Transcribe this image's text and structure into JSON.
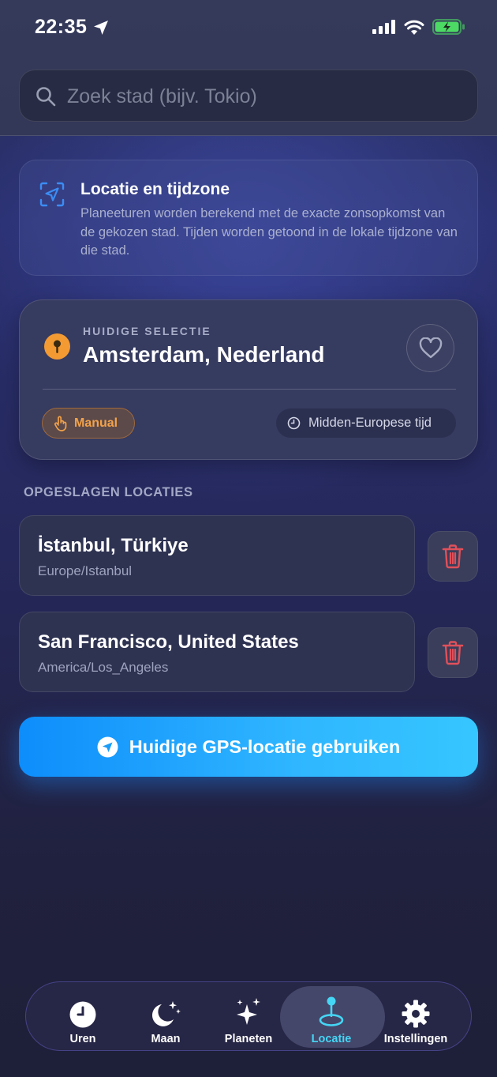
{
  "status_bar": {
    "time": "22:35"
  },
  "search": {
    "placeholder": "Zoek stad (bijv. Tokio)",
    "value": ""
  },
  "info": {
    "title": "Locatie en tijdzone",
    "text": "Planeeturen worden berekend met de exacte zonsopkomst van de gekozen stad. Tijden worden getoond in de lokale tijdzone van die stad."
  },
  "selection": {
    "label": "HUIDIGE SELECTIE",
    "city": "Amsterdam, Nederland",
    "mode_badge": "Manual",
    "timezone": "Midden-Europese tijd"
  },
  "saved": {
    "title": "OPGESLAGEN LOCATIES",
    "items": [
      {
        "name": "İstanbul, Türkiye",
        "tz": "Europe/Istanbul"
      },
      {
        "name": "San Francisco, United States",
        "tz": "America/Los_Angeles"
      }
    ]
  },
  "gps_button": {
    "label": "Huidige GPS-locatie gebruiken"
  },
  "tabs": [
    {
      "label": "Uren",
      "icon": "clock-icon"
    },
    {
      "label": "Maan",
      "icon": "moon-stars-icon"
    },
    {
      "label": "Planeten",
      "icon": "sparkles-icon"
    },
    {
      "label": "Locatie",
      "icon": "location-pin-icon",
      "active": true
    },
    {
      "label": "Instellingen",
      "icon": "gear-icon"
    }
  ],
  "colors": {
    "accent": "#45d6f5",
    "pin": "#f39a33",
    "delete": "#e0505a",
    "gps_start": "#0d8dfb",
    "gps_end": "#36c6ff"
  }
}
